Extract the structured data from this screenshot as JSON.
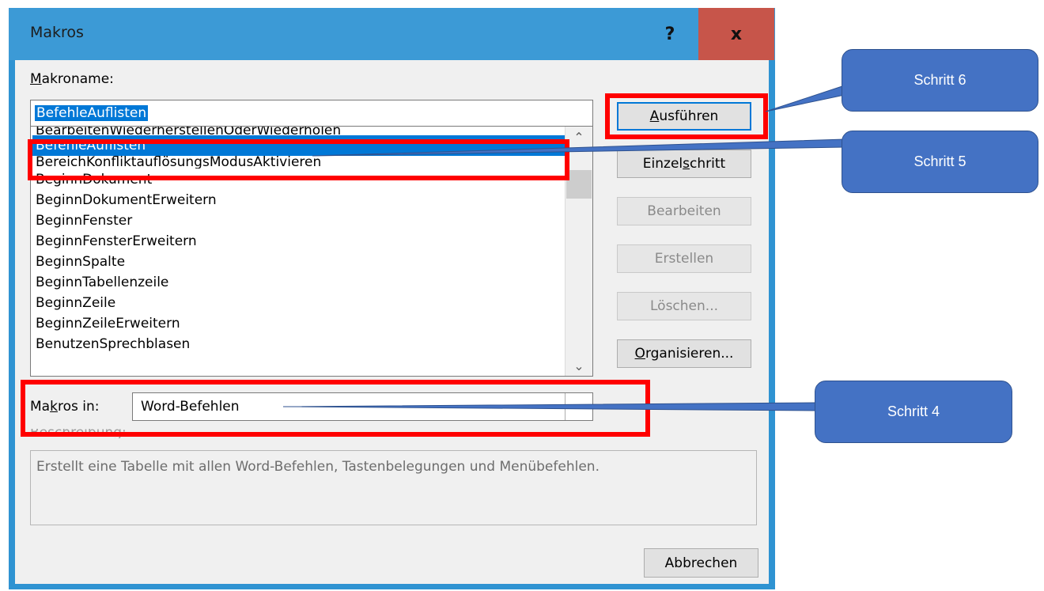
{
  "dialog": {
    "title": "Makros",
    "help_label": "?",
    "close_label": "x"
  },
  "macro_name": {
    "label_prefix": "M",
    "label_rest": "akroname:",
    "value": "BefehleAuflisten"
  },
  "macro_list": {
    "items": [
      "BearbeitenWiederherstellenOderWiederholen",
      "BefehleAuflisten",
      "BereichKonfliktauflösungsModusAktivieren",
      "BeginnDokument",
      "BeginnDokumentErweitern",
      "BeginnFenster",
      "BeginnFensterErweitern",
      "BeginnSpalte",
      "BeginnTabellenzeile",
      "BeginnZeile",
      "BeginnZeileErweitern",
      "BenutzenSprechblasen"
    ],
    "selected": "BefehleAuflisten"
  },
  "buttons": {
    "run_pre": "",
    "run_key": "A",
    "run_post": "usführen",
    "step_pre": "Einzel",
    "step_key": "s",
    "step_post": "chritt",
    "edit": "Bearbeiten",
    "create": "Erstellen",
    "delete": "Löschen...",
    "org_key": "O",
    "org_post": "rganisieren...",
    "cancel": "Abbrechen"
  },
  "macros_in": {
    "label_pre": "Ma",
    "label_key": "k",
    "label_post": "ros in:",
    "value": "Word-Befehlen"
  },
  "description": {
    "label": "Beschreibung:",
    "text": "Erstellt eine Tabelle mit allen Word-Befehlen, Tastenbelegungen und Menübefehlen."
  },
  "callouts": {
    "step6": "Schritt  6",
    "step5": "Schritt  5",
    "step4": "Schritt  4"
  },
  "colors": {
    "titlebar": "#3c9ad6",
    "close": "#c7554a",
    "selection": "#0078d7",
    "highlight": "#ff0000",
    "callout": "#4472c4"
  }
}
